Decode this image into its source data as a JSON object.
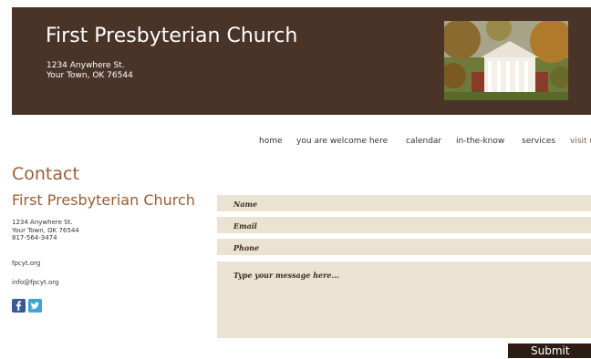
{
  "header": {
    "title": "First Presbyterian Church",
    "address_line1": "1234 Anywhere St.",
    "address_line2": "Your Town, OK 76544"
  },
  "nav": {
    "items": [
      "home",
      "you are welcome here",
      "calendar",
      "in-the-know",
      "services",
      "visit us"
    ],
    "active": "visit us"
  },
  "contact": {
    "heading": "Contact",
    "org_name": "First Presbyterian Church",
    "address_line1": "1234 Anywhere St.",
    "address_line2": "Your Town, OK 76544",
    "phone": "817-564-3474",
    "website": "fpcyt.org",
    "email": "info@fpcyt.org"
  },
  "social": {
    "facebook_icon": "facebook-icon",
    "twitter_icon": "twitter-icon"
  },
  "form": {
    "name_placeholder": "Name",
    "email_placeholder": "Email",
    "phone_placeholder": "Phone",
    "message_placeholder": "Type your message here...",
    "submit_label": "Submit"
  },
  "colors": {
    "header_bg": "#4a3428",
    "accent": "#9a5e35",
    "field_bg": "#ebe3d2",
    "submit_bg": "#2d1c14"
  }
}
